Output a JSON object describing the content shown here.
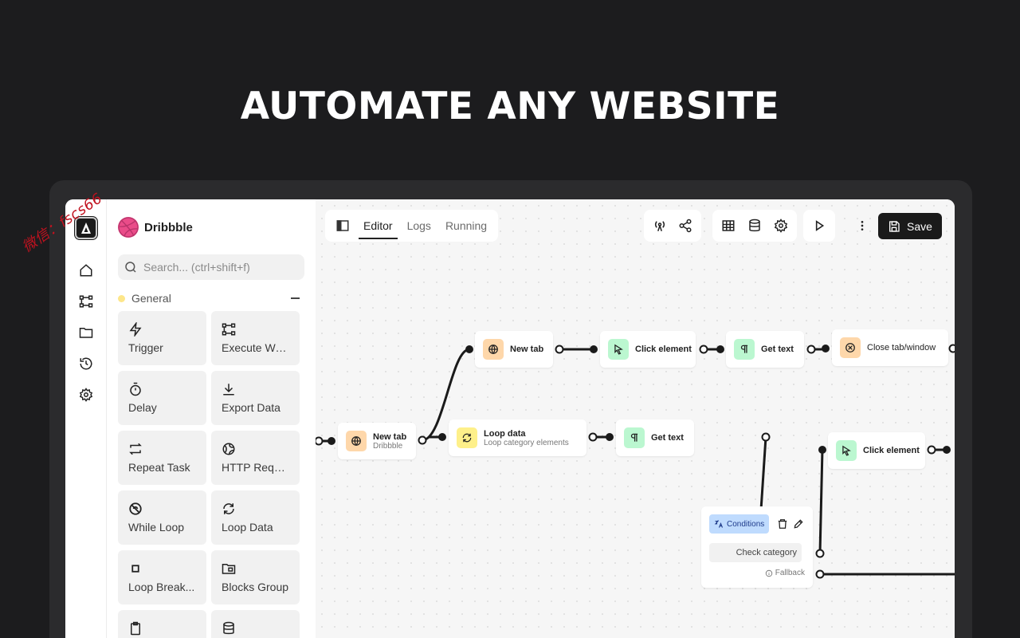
{
  "headline": "AUTOMATE ANY WEBSITE",
  "watermark": "微信：fscs66",
  "rail": {
    "items": [
      {
        "name": "home-icon"
      },
      {
        "name": "workflow-icon"
      },
      {
        "name": "folder-icon"
      },
      {
        "name": "history-icon"
      },
      {
        "name": "settings-icon"
      }
    ]
  },
  "sidebar": {
    "workflow_name": "Dribbble",
    "search_placeholder": "Search... (ctrl+shift+f)",
    "section_label": "General",
    "blocks": [
      {
        "label": "Trigger",
        "icon": "lightning-icon"
      },
      {
        "label": "Execute Wo...",
        "icon": "workflow-icon"
      },
      {
        "label": "Delay",
        "icon": "timer-icon"
      },
      {
        "label": "Export Data",
        "icon": "download-icon"
      },
      {
        "label": "Repeat Task",
        "icon": "repeat-icon"
      },
      {
        "label": "HTTP Requ...",
        "icon": "globe-icon"
      },
      {
        "label": "While Loop",
        "icon": "while-loop-icon"
      },
      {
        "label": "Loop Data",
        "icon": "loop-icon"
      },
      {
        "label": "Loop Break...",
        "icon": "stop-icon"
      },
      {
        "label": "Blocks Group",
        "icon": "folder-group-icon"
      }
    ]
  },
  "toolbar": {
    "tabs": [
      "Editor",
      "Logs",
      "Running"
    ],
    "active_tab": "Editor",
    "save_label": "Save"
  },
  "nodes": {
    "new_tab_1": {
      "title": "New tab"
    },
    "click_1": {
      "title": "Click element"
    },
    "get_text_1": {
      "title": "Get text"
    },
    "close_tab": {
      "title": "Close tab/window"
    },
    "new_tab_2": {
      "title": "New tab",
      "subtitle": "Dribbble"
    },
    "loop_data": {
      "title": "Loop data",
      "subtitle": "Loop category elements"
    },
    "get_text_2": {
      "title": "Get text"
    },
    "click_2": {
      "title": "Click element"
    },
    "conditions": {
      "badge": "Conditions",
      "path": "Check category",
      "fallback": "Fallback"
    }
  },
  "colors": {
    "orange_block": "#fed7aa",
    "green_block": "#bbf7d0",
    "yellow_block": "#fef08a",
    "blue_block": "#bfdbfe",
    "dribbble_pink": "#ea4c89"
  }
}
